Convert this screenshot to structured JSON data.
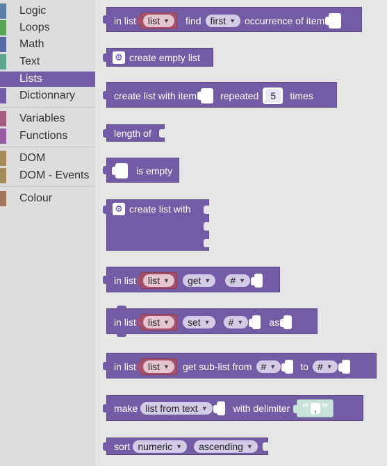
{
  "sidebar": {
    "categories": [
      {
        "label": "Logic",
        "color": "#5b80a5",
        "selected": false
      },
      {
        "label": "Loops",
        "color": "#5ba55b",
        "selected": false
      },
      {
        "label": "Math",
        "color": "#5b67a5",
        "selected": false
      },
      {
        "label": "Text",
        "color": "#5ba58c",
        "selected": false
      },
      {
        "label": "Lists",
        "color": "#745ba5",
        "selected": true
      },
      {
        "label": "Dictionnary",
        "color": "#745ba5",
        "selected": false
      },
      {
        "label": "Variables",
        "color": "#a55b80",
        "selected": false
      },
      {
        "label": "Functions",
        "color": "#995ba5",
        "selected": false
      },
      {
        "label": "DOM",
        "color": "#a58a5b",
        "selected": false
      },
      {
        "label": "DOM - Events",
        "color": "#a58a5b",
        "selected": false
      },
      {
        "label": "Colour",
        "color": "#a5745b",
        "selected": false
      }
    ]
  },
  "blocks": {
    "find_occurrence": {
      "in_list": "in list",
      "list_dd": "list",
      "find": "find",
      "first_dd": "first",
      "occurrence": "occurrence of item"
    },
    "create_empty": {
      "label": "create empty list"
    },
    "repeated": {
      "create": "create list with item",
      "repeated": "repeated",
      "count": "5",
      "times": "times"
    },
    "length_of": {
      "label": "length of"
    },
    "is_empty": {
      "label": "is empty"
    },
    "create_with": {
      "label": "create list with"
    },
    "get": {
      "in_list": "in list",
      "list_dd": "list",
      "get_dd": "get",
      "hash_dd": "#"
    },
    "set": {
      "in_list": "in list",
      "list_dd": "list",
      "set_dd": "set",
      "hash_dd": "#",
      "as": "as"
    },
    "sublist": {
      "in_list": "in list",
      "list_dd": "list",
      "get_sub": "get sub-list from",
      "from_dd": "#",
      "to": "to",
      "to_dd": "#"
    },
    "split": {
      "make": "make",
      "mode_dd": "list from text",
      "with_delim": "with delimiter",
      "open_q": "“",
      "delim": ",",
      "close_q": "”"
    },
    "sort": {
      "sort": "sort",
      "type_dd": "numeric",
      "order_dd": "ascending"
    }
  },
  "colors": {
    "list_block": "#745ba5",
    "dropdown_var": "#a5506b",
    "text_block": "#c8e4d8"
  }
}
